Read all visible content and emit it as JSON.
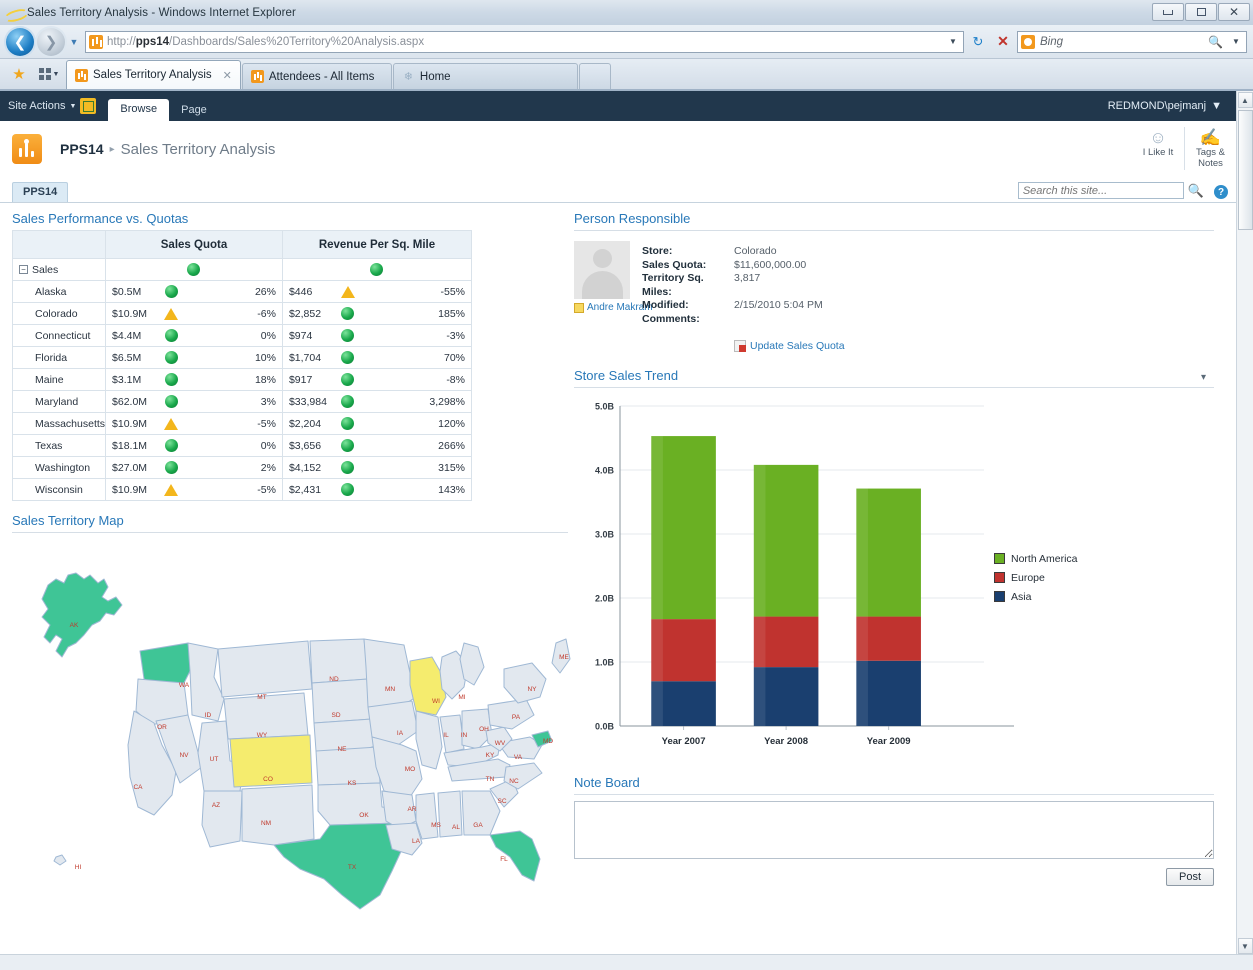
{
  "window": {
    "title": "Sales Territory Analysis - Windows Internet Explorer",
    "minimize_label": "Minimize",
    "maximize_label": "Maximize",
    "close_label": "Close"
  },
  "browser": {
    "url_prefix": "http://",
    "url_host": "pps14",
    "url_path": "/Dashboards/Sales%20Territory%20Analysis.aspx",
    "search_placeholder": "Bing",
    "tabs": [
      {
        "label": "Sales Territory Analysis",
        "active": true,
        "closable": true
      },
      {
        "label": "Attendees - All Items",
        "active": false,
        "closable": false
      },
      {
        "label": "Home",
        "active": false,
        "closable": false
      }
    ]
  },
  "sharepoint": {
    "site_actions": "Site Actions",
    "ribbon_tabs": [
      "Browse",
      "Page"
    ],
    "user": "REDMOND\\pejmanj",
    "breadcrumb_site": "PPS14",
    "breadcrumb_page": "Sales Territory Analysis",
    "social": [
      {
        "label": "I Like It",
        "icon": "tag-smile-icon"
      },
      {
        "label": "Tags & Notes",
        "icon": "tags-notes-icon"
      }
    ],
    "nav_tab": "PPS14",
    "search_placeholder": "Search this site...",
    "help_label": "?"
  },
  "scorecard": {
    "title": "Sales Performance vs. Quotas",
    "columns": [
      "",
      "Sales Quota",
      "Revenue Per Sq. Mile"
    ],
    "group_row": {
      "name": "Sales",
      "quota_status": "green",
      "revenue_status": "green"
    },
    "rows": [
      {
        "name": "Alaska",
        "quota_value": "$0.5M",
        "quota_status": "green",
        "quota_pct": "26%",
        "rev_value": "$446",
        "rev_status": "yellow",
        "rev_pct": "-55%"
      },
      {
        "name": "Colorado",
        "quota_value": "$10.9M",
        "quota_status": "yellow",
        "quota_pct": "-6%",
        "rev_value": "$2,852",
        "rev_status": "green",
        "rev_pct": "185%"
      },
      {
        "name": "Connecticut",
        "quota_value": "$4.4M",
        "quota_status": "green",
        "quota_pct": "0%",
        "rev_value": "$974",
        "rev_status": "green",
        "rev_pct": "-3%"
      },
      {
        "name": "Florida",
        "quota_value": "$6.5M",
        "quota_status": "green",
        "quota_pct": "10%",
        "rev_value": "$1,704",
        "rev_status": "green",
        "rev_pct": "70%"
      },
      {
        "name": "Maine",
        "quota_value": "$3.1M",
        "quota_status": "green",
        "quota_pct": "18%",
        "rev_value": "$917",
        "rev_status": "green",
        "rev_pct": "-8%"
      },
      {
        "name": "Maryland",
        "quota_value": "$62.0M",
        "quota_status": "green",
        "quota_pct": "3%",
        "rev_value": "$33,984",
        "rev_status": "green",
        "rev_pct": "3,298%"
      },
      {
        "name": "Massachusetts",
        "quota_value": "$10.9M",
        "quota_status": "yellow",
        "quota_pct": "-5%",
        "rev_value": "$2,204",
        "rev_status": "green",
        "rev_pct": "120%"
      },
      {
        "name": "Texas",
        "quota_value": "$18.1M",
        "quota_status": "green",
        "quota_pct": "0%",
        "rev_value": "$3,656",
        "rev_status": "green",
        "rev_pct": "266%"
      },
      {
        "name": "Washington",
        "quota_value": "$27.0M",
        "quota_status": "green",
        "quota_pct": "2%",
        "rev_value": "$4,152",
        "rev_status": "green",
        "rev_pct": "315%"
      },
      {
        "name": "Wisconsin",
        "quota_value": "$10.9M",
        "quota_status": "yellow",
        "quota_pct": "-5%",
        "rev_value": "$2,431",
        "rev_status": "green",
        "rev_pct": "143%"
      }
    ]
  },
  "map": {
    "title": "Sales Territory Map",
    "highlight_green": "#3fc596",
    "highlight_yellow": "#f5ec6e",
    "default_fill": "#e2e8ef",
    "border_color": "#9fb8d4",
    "label_color": "#c0392b",
    "green_states": [
      "AK",
      "WA",
      "TX",
      "FL",
      "MD"
    ],
    "yellow_states": [
      "CO",
      "WI"
    ]
  },
  "person": {
    "title": "Person Responsible",
    "name": "Andre Makram",
    "fields": [
      {
        "key": "Store:",
        "value": "Colorado"
      },
      {
        "key": "Sales Quota:",
        "value": "$11,600,000.00"
      },
      {
        "key": "Territory Sq. Miles:",
        "value": "3,817"
      },
      {
        "key": "Modified:",
        "value": "2/15/2010 5:04 PM"
      },
      {
        "key": "Comments:",
        "value": ""
      }
    ],
    "action_link": "Update Sales Quota"
  },
  "chart_panel": {
    "title": "Store Sales Trend",
    "menu_glyph": "▾"
  },
  "chart_data": {
    "type": "bar",
    "stacked": true,
    "title": "Store Sales Trend",
    "xlabel": "",
    "ylabel": "",
    "categories": [
      "Year 2007",
      "Year 2008",
      "Year 2009"
    ],
    "tick_labels": [
      "0.0B",
      "1.0B",
      "2.0B",
      "3.0B",
      "4.0B",
      "5.0B"
    ],
    "ylim": [
      0,
      5
    ],
    "grid": true,
    "legend_position": "right",
    "series": [
      {
        "name": "Asia",
        "color": "#1a3f6f",
        "values": [
          0.7,
          0.92,
          1.02
        ]
      },
      {
        "name": "Europe",
        "color": "#c0332f",
        "values": [
          0.97,
          0.79,
          0.69
        ]
      },
      {
        "name": "North America",
        "color": "#6ab023",
        "values": [
          2.86,
          2.37,
          2.0
        ]
      }
    ],
    "totals": [
      4.53,
      4.08,
      3.71
    ]
  },
  "noteboard": {
    "title": "Note Board",
    "textarea_value": "",
    "post_label": "Post"
  }
}
